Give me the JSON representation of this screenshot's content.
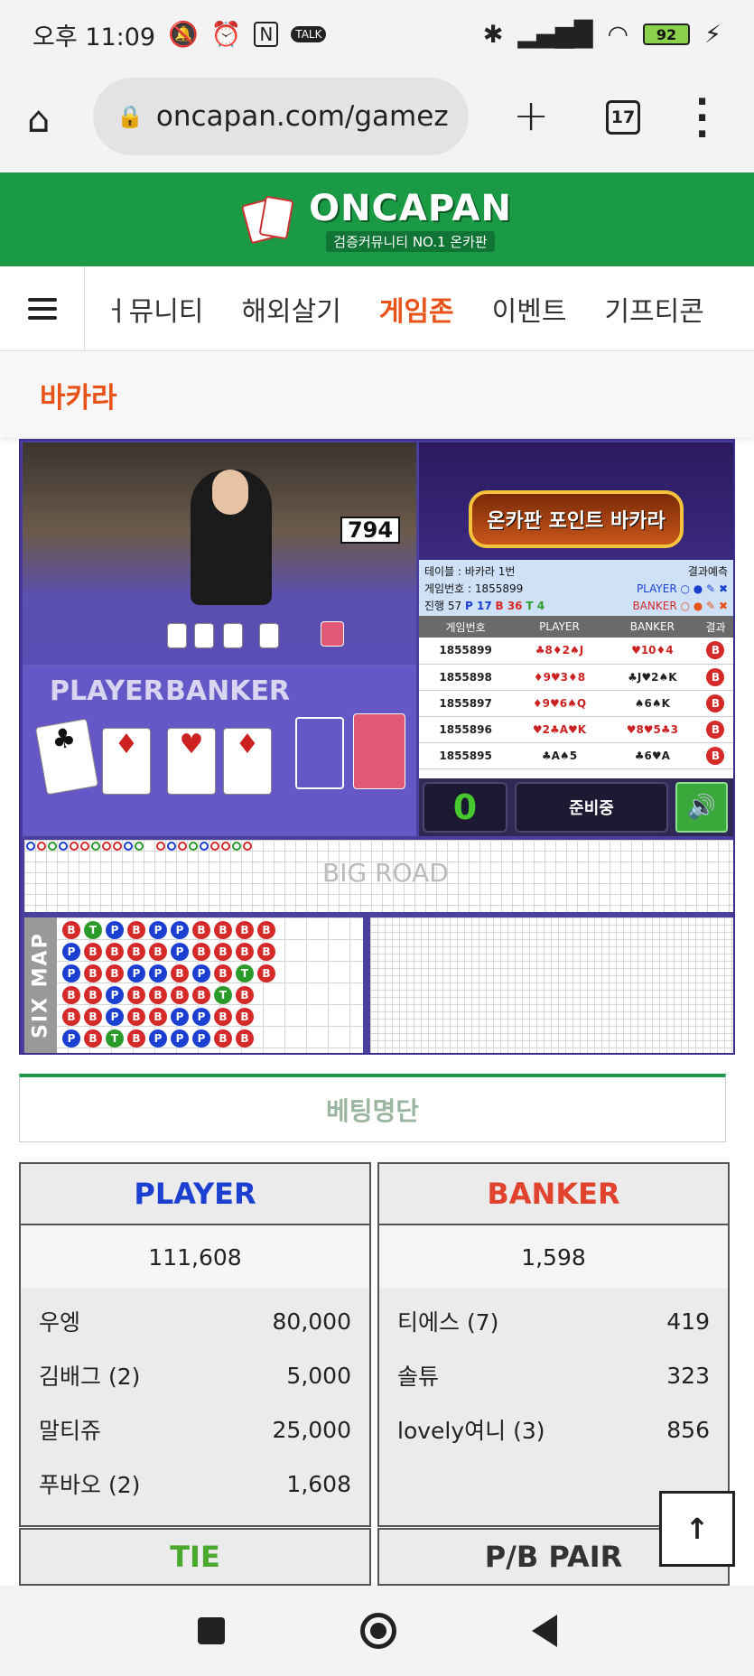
{
  "status_bar": {
    "time": "오후 11:09",
    "battery": "92"
  },
  "browser": {
    "url": "oncapan.com/gamez",
    "tab_count": "17"
  },
  "site": {
    "logo_title": "ONCAPAN",
    "logo_subtitle": "검증커뮤니티 NO.1 온카판"
  },
  "nav": {
    "items": [
      {
        "label": "ㅓ뮤니티"
      },
      {
        "label": "해외살기"
      },
      {
        "label": "게임존"
      },
      {
        "label": "이벤트"
      },
      {
        "label": "기프티콘"
      }
    ],
    "active_index": 2
  },
  "page": {
    "title": "바카라"
  },
  "game": {
    "video": {
      "counter": "794",
      "player_label": "PLAYER",
      "banker_label": "BANKER"
    },
    "banner": {
      "text": "온카판 포인트 바카라"
    },
    "info": {
      "table": "테이블 : 바카라 1번",
      "predict": "결과예측",
      "game_no": "게임번호 : 1855899",
      "player": "PLAYER",
      "banker": "BANKER",
      "progress": "진행 57",
      "p_count": "P 17",
      "b_count": "B 36",
      "t_count": "T 4"
    },
    "history_headers": [
      "게임번호",
      "PLAYER",
      "BANKER",
      "결과"
    ],
    "history": [
      {
        "no": "1855899",
        "player": "♣8♦2♠J",
        "banker": "♥10♦4",
        "result": "B"
      },
      {
        "no": "1855898",
        "player": "♦9♥3♦8",
        "banker": "♣J♥2♠K",
        "result": "B"
      },
      {
        "no": "1855897",
        "player": "♦9♥6♠Q",
        "banker": "♠6♠K",
        "result": "B"
      },
      {
        "no": "1855896",
        "player": "♥2♣A♥K",
        "banker": "♥8♥5♣3",
        "result": "B"
      },
      {
        "no": "1855895",
        "player": "♣A♠5",
        "banker": "♣6♥A",
        "result": "B"
      }
    ],
    "controls": {
      "count": "0",
      "status": "준비중"
    },
    "bigroad_label": "BIG ROAD",
    "sixmap_label": "SIX MAP",
    "sixmap": [
      [
        "B",
        "T",
        "P",
        "B",
        "P",
        "P",
        "B",
        "B",
        "B",
        "B"
      ],
      [
        "P",
        "B",
        "B",
        "B",
        "B",
        "P",
        "B",
        "B",
        "B",
        "B"
      ],
      [
        "P",
        "B",
        "B",
        "P",
        "P",
        "B",
        "P",
        "B",
        "T",
        "B"
      ],
      [
        "B",
        "B",
        "P",
        "B",
        "B",
        "B",
        "B",
        "T",
        "B",
        ""
      ],
      [
        "B",
        "B",
        "P",
        "B",
        "B",
        "P",
        "P",
        "B",
        "B",
        ""
      ],
      [
        "P",
        "B",
        "T",
        "B",
        "P",
        "P",
        "P",
        "B",
        "B",
        ""
      ]
    ]
  },
  "bets": {
    "section_title": "베팅명단",
    "player": {
      "title": "PLAYER",
      "total": "111,608",
      "rows": [
        {
          "name": "우엥",
          "amount": "80,000"
        },
        {
          "name": "김배그 (2)",
          "amount": "5,000"
        },
        {
          "name": "말티쥬",
          "amount": "25,000"
        },
        {
          "name": "푸바오 (2)",
          "amount": "1,608"
        }
      ]
    },
    "banker": {
      "title": "BANKER",
      "total": "1,598",
      "rows": [
        {
          "name": "티에스 (7)",
          "amount": "419"
        },
        {
          "name": "솔튜",
          "amount": "323"
        },
        {
          "name": "lovely여니 (3)",
          "amount": "856"
        }
      ]
    },
    "tie_title": "TIE",
    "pair_title": "P/B PAIR"
  },
  "colors": {
    "brand_green": "#1a9a45",
    "accent_orange": "#e8531a",
    "player_blue": "#1a3fd1",
    "banker_red": "#e0442e",
    "tie_green": "#4aa82e"
  }
}
